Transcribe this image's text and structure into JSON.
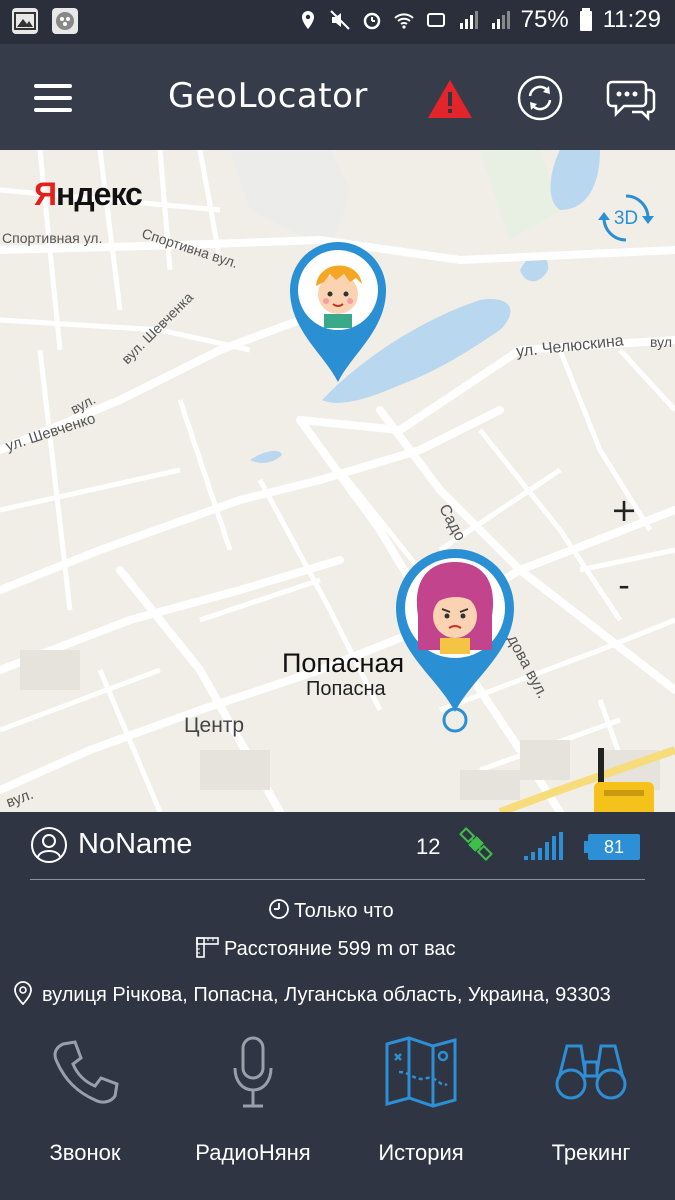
{
  "status_bar": {
    "battery_percent": "75%",
    "time": "11:29"
  },
  "app_bar": {
    "title": "GeoLocator",
    "icons": [
      "menu-icon",
      "alert-icon",
      "refresh-icon",
      "chat-icon"
    ],
    "alert_color": "#e3242b"
  },
  "map": {
    "provider_logo": "Яндекс",
    "btn_3d": "3D",
    "zoom_in": "+",
    "zoom_out": "-",
    "street_labels": {
      "sportivnaya": "Спортивная ул.",
      "sportivna": "Спортивна вул.",
      "shevchenko_ua": "вул. Шевченка",
      "shevchenko": "ул. Шевченко",
      "shevchenko_prefix": "вул.",
      "chelyuskina": "ул. Челюскина",
      "chelyuskina_suffix": "вул",
      "sadovaya": "Садо",
      "sadova": "дова вул.",
      "bottom_left": "вул."
    },
    "town_name": "Попасная",
    "town_name_ua": "Попасна",
    "district": "Центр",
    "pins": [
      "boy-avatar-pin",
      "girl-avatar-pin"
    ],
    "accent_color": "#2b8fd4"
  },
  "device": {
    "name": "NoName",
    "satellites": "12",
    "battery": "81",
    "last_seen": "Только что",
    "distance": "Расстояние 599 m от вас",
    "address": "вулиця Річкова, Попасна, Луганська область, Украина, 93303"
  },
  "actions": [
    {
      "label": "Звонок",
      "icon": "phone-icon"
    },
    {
      "label": "РадиоНяня",
      "icon": "microphone-icon"
    },
    {
      "label": "История",
      "icon": "map-history-icon"
    },
    {
      "label": "Трекинг",
      "icon": "binoculars-icon"
    }
  ]
}
